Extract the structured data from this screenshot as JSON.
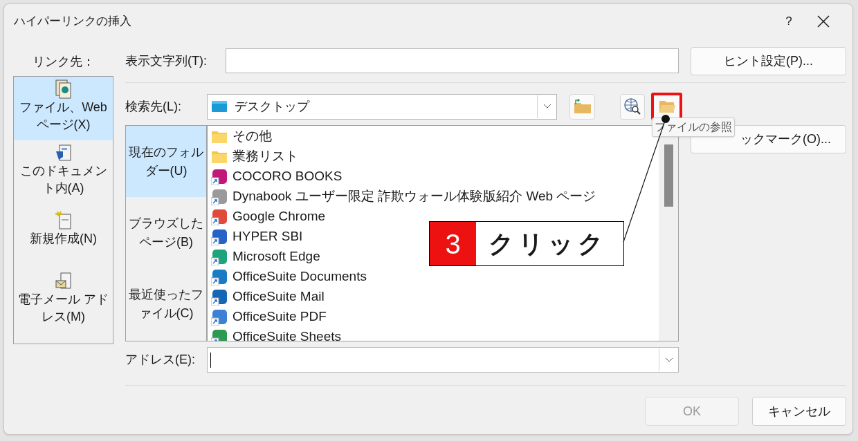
{
  "window": {
    "title": "ハイパーリンクの挿入",
    "help": "?"
  },
  "link_to": {
    "label": "リンク先：",
    "items": [
      {
        "kind": "file",
        "label": "ファイル、Web ページ(X)",
        "selected": true
      },
      {
        "kind": "document",
        "label": "このドキュメント内(A)",
        "selected": false
      },
      {
        "kind": "new",
        "label": "新規作成(N)",
        "selected": false
      },
      {
        "kind": "email",
        "label": "電子メール アドレス(M)",
        "selected": false
      }
    ]
  },
  "display_text": {
    "label": "表示文字列(T):"
  },
  "hint_button": "ヒント設定(P)...",
  "look_in": {
    "label": "検索先(L):",
    "value": "デスクトップ"
  },
  "tooltip": "ファイルの参照",
  "bookmark_button": "ックマーク(O)...",
  "view_tabs": [
    {
      "label": "現在のフォルダー(U)",
      "selected": true
    },
    {
      "label": "ブラウズしたページ(B)",
      "selected": false
    },
    {
      "label": "最近使ったファイル(C)",
      "selected": false
    }
  ],
  "files": [
    {
      "kind": "folder",
      "name": "その他"
    },
    {
      "kind": "folder",
      "name": "業務リスト"
    },
    {
      "kind": "shortcut",
      "name": "COCORO BOOKS",
      "color": "#c2187a"
    },
    {
      "kind": "shortcut",
      "name": "Dynabook ユーザー限定 詐欺ウォール体験版紹介 Web ページ",
      "color": "#9a9a9a"
    },
    {
      "kind": "shortcut",
      "name": "Google Chrome",
      "color": "#e04a3a"
    },
    {
      "kind": "shortcut",
      "name": "HYPER SBI",
      "color": "#2563c9"
    },
    {
      "kind": "shortcut",
      "name": "Microsoft Edge",
      "color": "#1fa37a"
    },
    {
      "kind": "shortcut",
      "name": "OfficeSuite Documents",
      "color": "#1a7ac4"
    },
    {
      "kind": "shortcut",
      "name": "OfficeSuite Mail",
      "color": "#1566b5"
    },
    {
      "kind": "shortcut",
      "name": "OfficeSuite PDF",
      "color": "#3b82d6"
    },
    {
      "kind": "shortcut",
      "name": "OfficeSuite Sheets",
      "color": "#2e9a4f"
    }
  ],
  "address": {
    "label": "アドレス(E):"
  },
  "annotation": {
    "number": "3",
    "text": "クリック"
  },
  "buttons": [
    {
      "label": "OK",
      "disabled": true
    },
    {
      "label": "キャンセル",
      "disabled": false
    }
  ]
}
